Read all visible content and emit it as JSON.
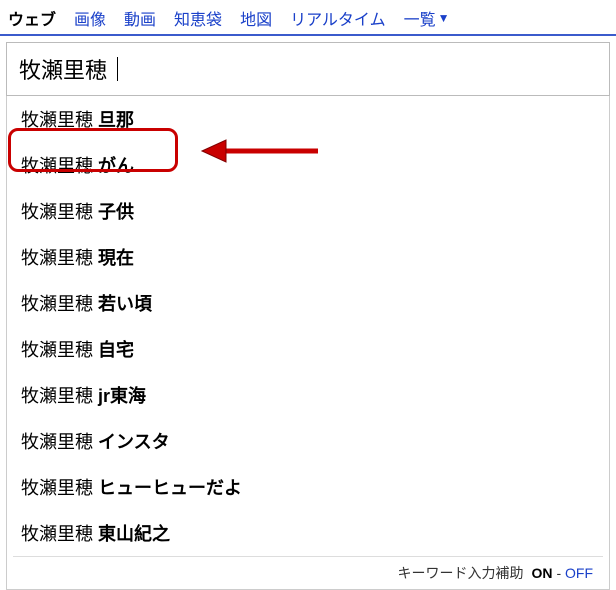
{
  "tabs": {
    "items": [
      {
        "label": "ウェブ",
        "active": true
      },
      {
        "label": "画像",
        "active": false
      },
      {
        "label": "動画",
        "active": false
      },
      {
        "label": "知恵袋",
        "active": false
      },
      {
        "label": "地図",
        "active": false
      },
      {
        "label": "リアルタイム",
        "active": false
      }
    ],
    "more_label": "一覧"
  },
  "search": {
    "query": "牧瀬里穂"
  },
  "suggestions": {
    "prefix": "牧瀬里穂",
    "items": [
      {
        "suffix": "旦那"
      },
      {
        "suffix": "がん",
        "highlighted": true
      },
      {
        "suffix": "子供"
      },
      {
        "suffix": "現在"
      },
      {
        "suffix": "若い頃"
      },
      {
        "suffix": "自宅"
      },
      {
        "suffix": "jr東海"
      },
      {
        "suffix": "インスタ"
      },
      {
        "suffix": "ヒューヒューだよ"
      },
      {
        "suffix": "東山紀之"
      }
    ]
  },
  "footer": {
    "label": "キーワード入力補助",
    "on": "ON",
    "sep": "-",
    "off": "OFF"
  },
  "annotation": {
    "highlight_color": "#c90000",
    "arrow_color": "#c90000"
  }
}
